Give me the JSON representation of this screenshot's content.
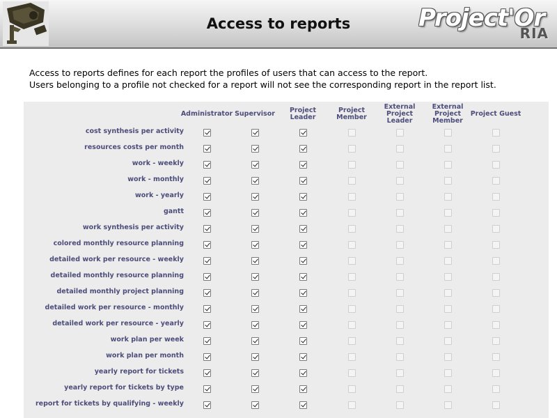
{
  "header": {
    "title": "Access to reports",
    "brand": "Project'Or",
    "brand_sub": "RIA"
  },
  "intro": [
    "Access to reports defines for each report the profiles of users that can access to the report.",
    "Users belonging to a profile not checked for a report will not see the corresponding report in the report list."
  ],
  "profiles": [
    [
      "Administrator"
    ],
    [
      "Supervisor"
    ],
    [
      "Project",
      "Leader"
    ],
    [
      "Project",
      "Member"
    ],
    [
      "External",
      "Project",
      "Leader"
    ],
    [
      "External",
      "Project",
      "Member"
    ],
    [
      "Project Guest"
    ]
  ],
  "reports": [
    {
      "label": "cost synthesis per activity",
      "access": [
        true,
        true,
        true,
        false,
        false,
        false,
        false
      ]
    },
    {
      "label": "resources costs per month",
      "access": [
        true,
        true,
        true,
        false,
        false,
        false,
        false
      ]
    },
    {
      "label": "work - weekly",
      "access": [
        true,
        true,
        true,
        false,
        false,
        false,
        false
      ]
    },
    {
      "label": "work - monthly",
      "access": [
        true,
        true,
        true,
        false,
        false,
        false,
        false
      ]
    },
    {
      "label": "work - yearly",
      "access": [
        true,
        true,
        true,
        false,
        false,
        false,
        false
      ]
    },
    {
      "label": "gantt",
      "access": [
        true,
        true,
        true,
        false,
        false,
        false,
        false
      ]
    },
    {
      "label": "work synthesis per activity",
      "access": [
        true,
        true,
        true,
        false,
        false,
        false,
        false
      ]
    },
    {
      "label": "colored monthly resource planning",
      "access": [
        true,
        true,
        true,
        false,
        false,
        false,
        false
      ]
    },
    {
      "label": "detailed work per resource - weekly",
      "access": [
        true,
        true,
        true,
        false,
        false,
        false,
        false
      ]
    },
    {
      "label": "detailed monthly resource planning",
      "access": [
        true,
        true,
        true,
        false,
        false,
        false,
        false
      ]
    },
    {
      "label": "detailed monthly project planning",
      "access": [
        true,
        true,
        true,
        false,
        false,
        false,
        false
      ]
    },
    {
      "label": "detailed work per resource - monthly",
      "access": [
        true,
        true,
        true,
        false,
        false,
        false,
        false
      ]
    },
    {
      "label": "detailed work per resource - yearly",
      "access": [
        true,
        true,
        true,
        false,
        false,
        false,
        false
      ]
    },
    {
      "label": "work plan per week",
      "access": [
        true,
        true,
        true,
        false,
        false,
        false,
        false
      ]
    },
    {
      "label": "work plan per month",
      "access": [
        true,
        true,
        true,
        false,
        false,
        false,
        false
      ]
    },
    {
      "label": "yearly report for tickets",
      "access": [
        true,
        true,
        true,
        false,
        false,
        false,
        false
      ]
    },
    {
      "label": "yearly report for tickets by type",
      "access": [
        true,
        true,
        true,
        false,
        false,
        false,
        false
      ]
    },
    {
      "label": "report for tickets by qualifying - weekly",
      "access": [
        true,
        true,
        true,
        false,
        false,
        false,
        false
      ]
    }
  ],
  "colors": {
    "label_text": "#4c4d7a",
    "grid_background": "#ececec",
    "header_border": "#6f6f6f"
  },
  "icons": {
    "left_logo": "camera-logo-icon"
  }
}
